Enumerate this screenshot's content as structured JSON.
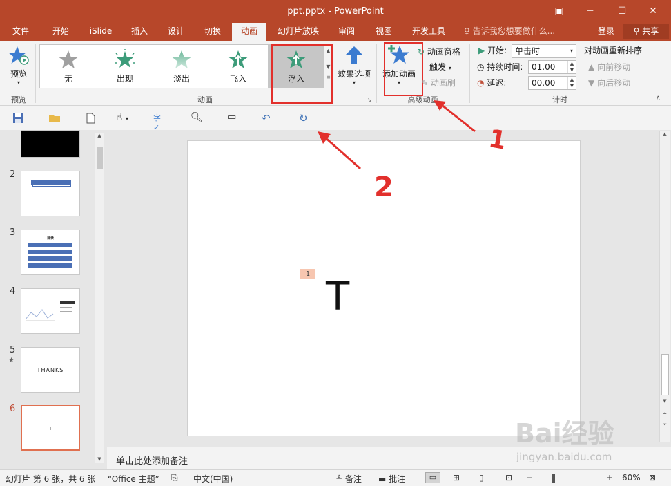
{
  "window": {
    "title": "ppt.pptx - PowerPoint",
    "controls": [
      "ribbon-display-icon",
      "minimize-icon",
      "maximize-icon",
      "close-icon"
    ]
  },
  "tabs": [
    {
      "label": "文件"
    },
    {
      "label": "开始"
    },
    {
      "label": "iSlide"
    },
    {
      "label": "插入"
    },
    {
      "label": "设计"
    },
    {
      "label": "切换"
    },
    {
      "label": "动画",
      "active": true
    },
    {
      "label": "幻灯片放映"
    },
    {
      "label": "审阅"
    },
    {
      "label": "视图"
    },
    {
      "label": "开发工具"
    }
  ],
  "tellme": "告诉我您想要做什么...",
  "account": {
    "login": "登录",
    "share": "共享"
  },
  "ribbon": {
    "preview": {
      "label": "预览",
      "group": "预览"
    },
    "animation_group": "动画",
    "animations": [
      {
        "label": "无",
        "color": "#a0a0a0"
      },
      {
        "label": "出现",
        "color": "#3d9c7a"
      },
      {
        "label": "淡出",
        "color": "#6fb89c"
      },
      {
        "label": "飞入",
        "color": "#3d9c7a"
      },
      {
        "label": "浮入",
        "color": "#3d9c7a",
        "selected": true
      }
    ],
    "effect_options": "效果选项",
    "advanced": {
      "add_animation": "添加动画",
      "animation_pane": "动画窗格",
      "trigger": "触发",
      "animation_painter": "动画刷",
      "group": "高级动画"
    },
    "timing": {
      "start_label": "开始:",
      "start_value": "单击时",
      "duration_label": "持续时间:",
      "duration_value": "01.00",
      "delay_label": "延迟:",
      "delay_value": "00.00",
      "reorder_title": "对动画重新排序",
      "move_earlier": "向前移动",
      "move_later": "向后移动",
      "group": "计时"
    }
  },
  "annotations": {
    "one": "1",
    "two": "2"
  },
  "thumbnails": [
    {
      "num": ""
    },
    {
      "num": "2"
    },
    {
      "num": "3",
      "title": "目录"
    },
    {
      "num": "4"
    },
    {
      "num": "5",
      "text": "THANKS",
      "star": "★"
    },
    {
      "num": "6",
      "text": "T",
      "selected": true
    }
  ],
  "slide": {
    "anim_tag": "1",
    "text": "T"
  },
  "notes_placeholder": "单击此处添加备注",
  "status": {
    "slide_info": "幻灯片 第 6 张，共 6 张",
    "theme": "“Office 主题”",
    "language": "中文(中国)",
    "notes": "备注",
    "comments": "批注",
    "zoom": "60%"
  },
  "watermark": {
    "brand": "Bai经验",
    "url": "jingyan.baidu.com"
  },
  "colors": {
    "accent": "#b7472a",
    "highlight": "#e2302c",
    "star": "#3d9c7a",
    "blue": "#3b7bd0"
  }
}
